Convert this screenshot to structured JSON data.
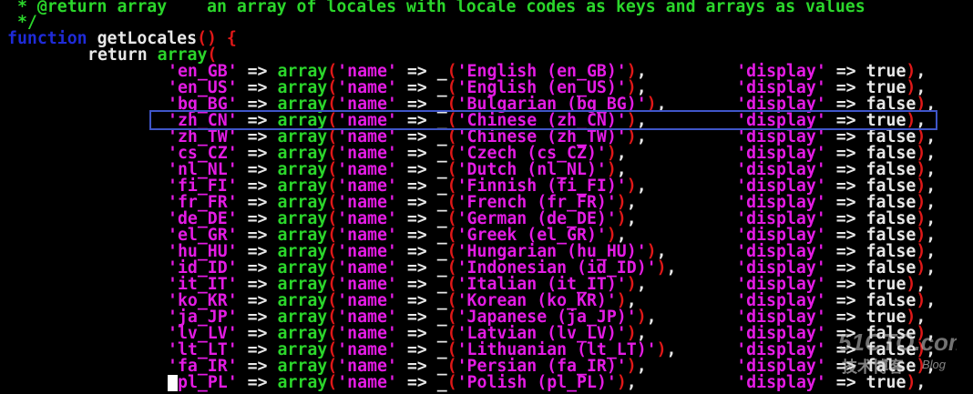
{
  "editor": {
    "header_lines": [
      " * @return array    an array of locales with locale codes as keys and arrays as values",
      " */"
    ],
    "function_keyword": "function",
    "function_name": "getLocales",
    "function_parens": "()",
    "function_brace": "{",
    "return_keyword": "return",
    "array_keyword": "array",
    "array_open": "(",
    "locales": [
      {
        "code": "en_GB",
        "label": "English (en_GB)",
        "display": "true"
      },
      {
        "code": "en_US",
        "label": "English (en_US)",
        "display": "true"
      },
      {
        "code": "bg_BG",
        "label": "Bulgarian (bg_BG)",
        "display": "false"
      },
      {
        "code": "zh_CN",
        "label": "Chinese (zh_CN)",
        "display": "true"
      },
      {
        "code": "zh_TW",
        "label": "Chinese (zh_TW)",
        "display": "false"
      },
      {
        "code": "cs_CZ",
        "label": "Czech (cs_CZ)",
        "display": "false"
      },
      {
        "code": "nl_NL",
        "label": "Dutch (nl_NL)",
        "display": "false"
      },
      {
        "code": "fi_FI",
        "label": "Finnish (fi_FI)",
        "display": "false"
      },
      {
        "code": "fr_FR",
        "label": "French (fr_FR)",
        "display": "false"
      },
      {
        "code": "de_DE",
        "label": "German (de_DE)",
        "display": "false"
      },
      {
        "code": "el_GR",
        "label": "Greek (el_GR)",
        "display": "false"
      },
      {
        "code": "hu_HU",
        "label": "Hungarian (hu_HU)",
        "display": "false"
      },
      {
        "code": "id_ID",
        "label": "Indonesian (id_ID)",
        "display": "false"
      },
      {
        "code": "it_IT",
        "label": "Italian (it_IT)",
        "display": "true"
      },
      {
        "code": "ko_KR",
        "label": "Korean (ko_KR)",
        "display": "false"
      },
      {
        "code": "ja_JP",
        "label": "Japanese (ja_JP)",
        "display": "true"
      },
      {
        "code": "lv_LV",
        "label": "Latvian (lv_LV)",
        "display": "false"
      },
      {
        "code": "lt_LT",
        "label": "Lithuanian (lt_LT)",
        "display": "false"
      },
      {
        "code": "fa_IR",
        "label": "Persian (fa_IR)",
        "display": "false"
      },
      {
        "code": "pl_PL",
        "label": "Polish (pl_PL)",
        "display": "true"
      }
    ],
    "highlighted_code": "zh_CN",
    "watermark": {
      "brand": "51CTO.com",
      "subtitle": "技术博客",
      "tag": "Blog"
    },
    "colors": {
      "background": "#000000",
      "keyword": "#1f2bd8",
      "plain_text": "#e8e8e8",
      "array_keyword": "#2bd62b",
      "string": "#e41be4",
      "paren": "#e01818",
      "highlight_box": "#3f55c8"
    }
  }
}
